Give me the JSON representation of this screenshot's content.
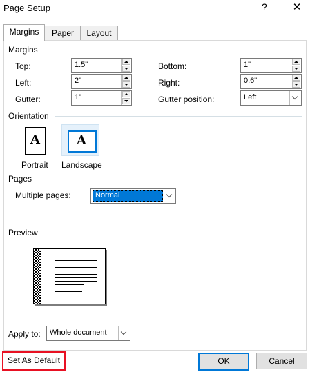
{
  "window": {
    "title": "Page Setup",
    "help_glyph": "?",
    "close_glyph": "✕"
  },
  "tabs": [
    {
      "label": "Margins",
      "active": true
    },
    {
      "label": "Paper",
      "active": false
    },
    {
      "label": "Layout",
      "active": false
    }
  ],
  "margins": {
    "section_label": "Margins",
    "top": {
      "label": "Top:",
      "value": "1.5\""
    },
    "bottom": {
      "label": "Bottom:",
      "value": "1\""
    },
    "left": {
      "label": "Left:",
      "value": "2\""
    },
    "right": {
      "label": "Right:",
      "value": "0.6\""
    },
    "gutter": {
      "label": "Gutter:",
      "value": "1\""
    },
    "gutter_position": {
      "label": "Gutter position:",
      "value": "Left"
    }
  },
  "orientation": {
    "section_label": "Orientation",
    "portrait": {
      "label": "Portrait",
      "glyph": "A"
    },
    "landscape": {
      "label": "Landscape",
      "glyph": "A",
      "selected": true
    }
  },
  "pages": {
    "section_label": "Pages",
    "multiple_pages_label": "Multiple pages:",
    "multiple_pages_value": "Normal"
  },
  "preview": {
    "section_label": "Preview"
  },
  "apply_to": {
    "label": "Apply to:",
    "value": "Whole document"
  },
  "buttons": {
    "set_default": "Set As Default",
    "ok": "OK",
    "cancel": "Cancel"
  },
  "colors": {
    "accent": "#0078d7",
    "highlight_outline": "#e81123",
    "selection_bg": "#e5f1fb"
  },
  "icons": {
    "help": "help-icon",
    "close": "close-icon",
    "spin_up": "spin-up-icon",
    "spin_down": "spin-down-icon",
    "dropdown": "chevron-down-icon"
  }
}
